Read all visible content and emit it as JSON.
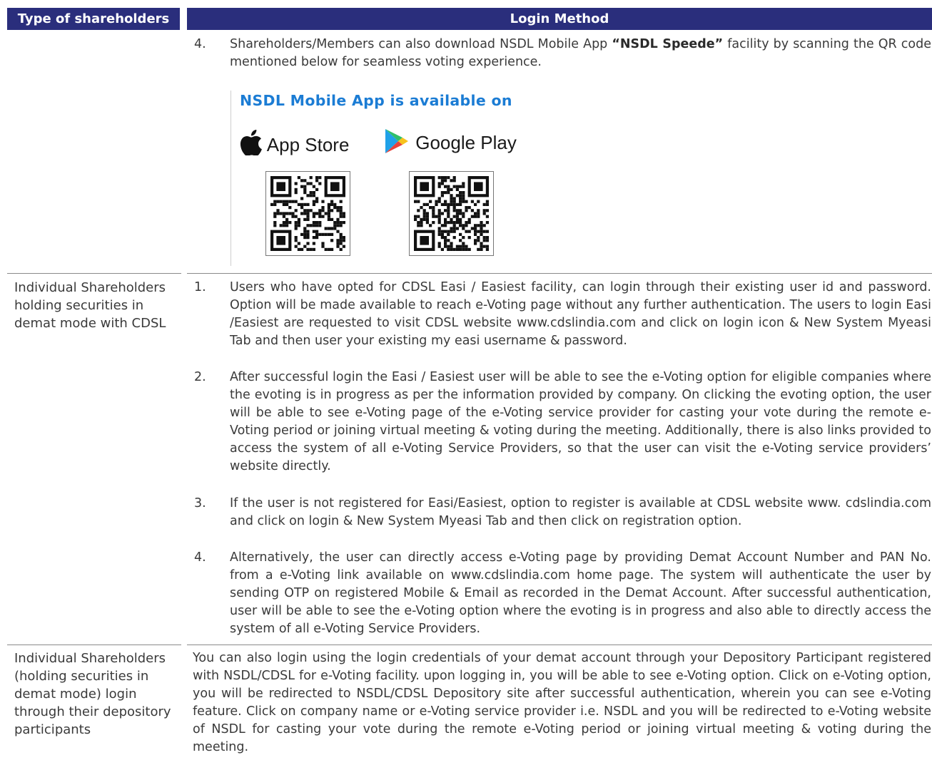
{
  "header": {
    "col1": "Type of shareholders",
    "col2": "Login Method"
  },
  "nsdl_block": {
    "num": "4.",
    "text_pre": "Shareholders/Members can also download NSDL Mobile App ",
    "text_bold": "“NSDL Speede”",
    "text_post": " facility by scanning the QR code mentioned below for seamless voting experience.",
    "app_heading": "NSDL Mobile App is available on",
    "app_store_label": "App Store",
    "google_play_label": "Google Play",
    "icons": [
      "apple-icon",
      "google-play-icon",
      "qr-code-app-store",
      "qr-code-google-play"
    ]
  },
  "cdsl": {
    "label": "Individual Shareholders holding securities in demat mode with CDSL",
    "items": [
      {
        "num": "1.",
        "text": "Users who have opted for CDSL Easi / Easiest facility, can login through their existing user id and password. Option will be made available to reach e-Voting page without any further authentication. The users to login Easi /Easiest are requested to visit CDSL website www.cdslindia.com and click on login icon & New System Myeasi Tab and then user your existing my easi username & password."
      },
      {
        "num": "2.",
        "text": "After successful login the Easi / Easiest user will be able to see the e-Voting option for eligible companies where the evoting is in progress as per the information provided by company. On clicking the evoting option, the user will be able to see e-Voting page of the e-Voting service provider for casting your vote during the remote e-Voting period or joining virtual meeting & voting during the meeting. Additionally, there is also links provided to access the system of all e-Voting Service Providers, so that the user can visit the e-Voting service providers’ website directly."
      },
      {
        "num": "3.",
        "text": "If the user is not registered for Easi/Easiest, option to register is available at CDSL website www. cdslindia.com and click on login & New System Myeasi Tab and then click on registration option."
      },
      {
        "num": "4.",
        "text": "Alternatively, the user can directly access e-Voting page by providing Demat Account Number and PAN No. from a e-Voting link available on www.cdslindia.com home page. The system will authenticate the user by sending OTP on registered Mobile & Email as recorded in the Demat Account. After successful authentication, user will be able to see the e-Voting option where the evoting is in progress and also able to directly access the system of all e-Voting Service Providers."
      }
    ]
  },
  "dp": {
    "label": "Individual Shareholders (holding securities in demat mode) login through their depository participants",
    "text": "You can also login using the login credentials of your demat account through your Depository Participant registered with NSDL/CDSL for e-Voting facility. upon logging in, you will be able to see e-Voting option. Click on e-Voting option, you will be redirected to NSDL/CDSL Depository site after successful authentication, wherein you can see e-Voting feature. Click on company name or e-Voting service provider i.e. NSDL and you will be redirected to e-Voting website of NSDL for casting your vote during the remote e-Voting period or joining virtual meeting & voting during the meeting."
  },
  "colors": {
    "header_bg": "#2a2e7c",
    "app_heading": "#1b7cd4"
  }
}
